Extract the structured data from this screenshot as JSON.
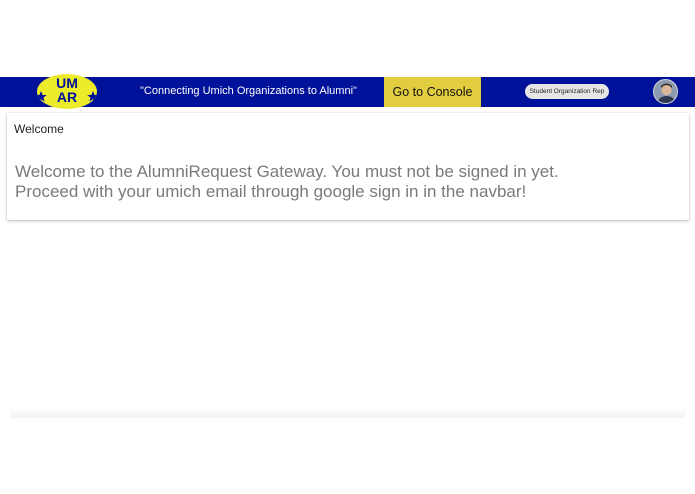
{
  "navbar": {
    "logo": {
      "line1": "UM",
      "line2": "AR"
    },
    "tagline": "\"Connecting Umich Organizations to Alumni\"",
    "console_button": "Go to Console",
    "role_badge": "Student Organization Rep",
    "avatar_icon": "user-avatar-icon",
    "colors": {
      "background": "#00119a",
      "console_button": "#e2cd3e",
      "logo": "#ecec2a"
    }
  },
  "card": {
    "title": "Welcome",
    "message_lines": [
      "Welcome to the AlumniRequest Gateway. You must not be signed in yet.",
      "Proceed with your umich email through google sign in in the navbar!"
    ]
  }
}
